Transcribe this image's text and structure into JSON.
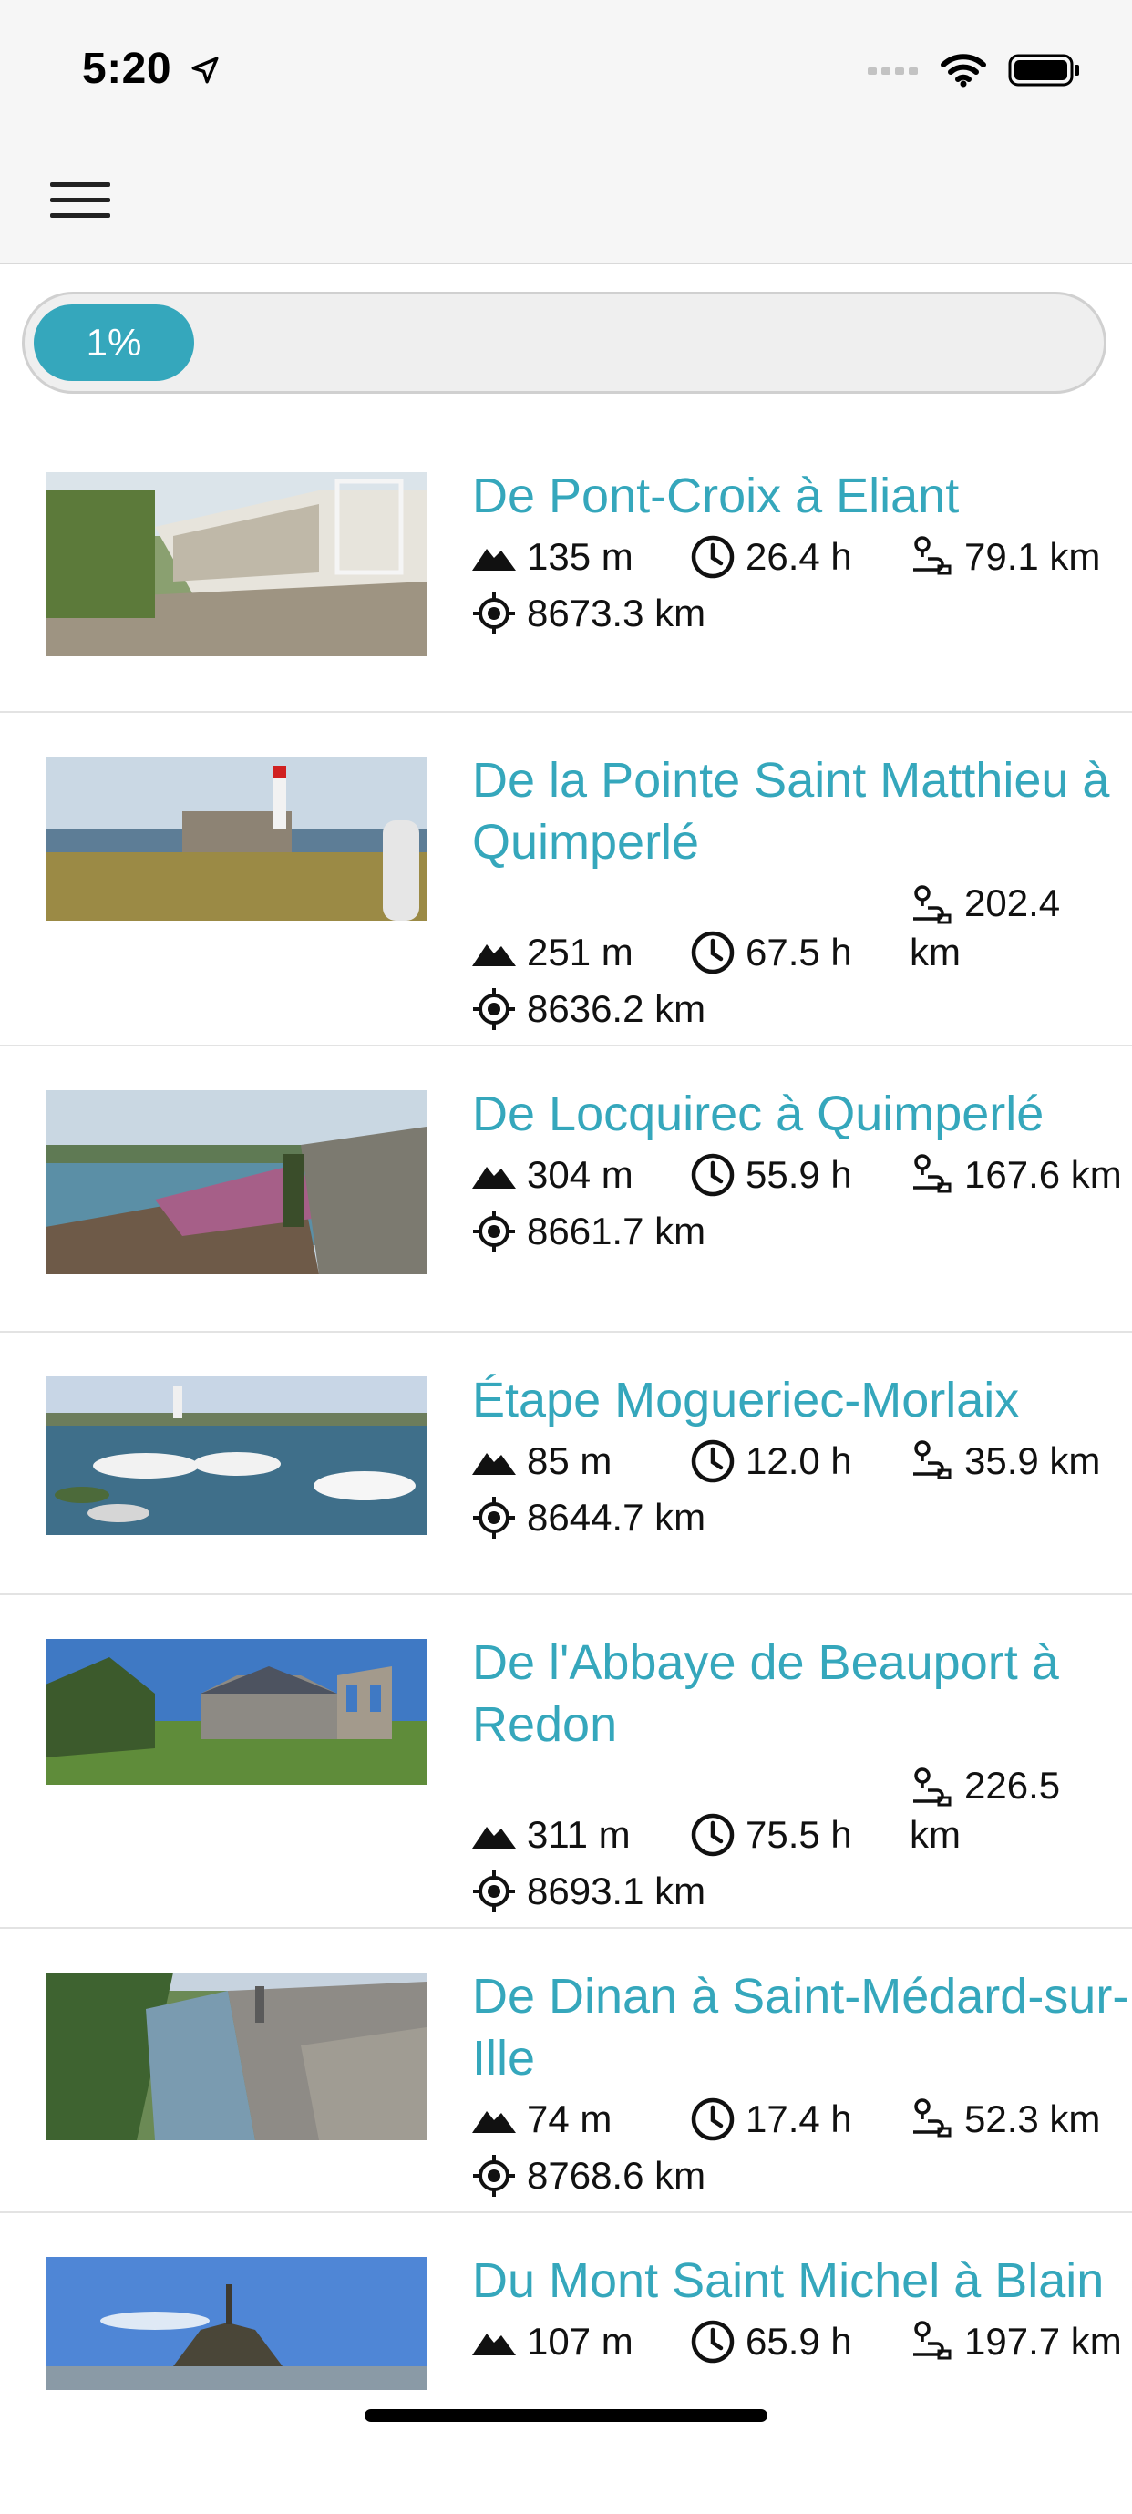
{
  "status": {
    "time": "5:20"
  },
  "progress": {
    "label": "1%",
    "value": 0.01
  },
  "items": [
    {
      "title": "De Pont-Croix à Eliant",
      "elevation": "135 m",
      "duration": "26.4 h",
      "distance": "79.1 km",
      "position": "8673.3 km"
    },
    {
      "title": "De la Pointe Saint Matthieu à Quimperlé",
      "elevation": "251 m",
      "duration": "67.5 h",
      "distance": "202.4 km",
      "position": "8636.2 km"
    },
    {
      "title": "De Locquirec à Quimperlé",
      "elevation": "304 m",
      "duration": "55.9 h",
      "distance": "167.6 km",
      "position": "8661.7 km"
    },
    {
      "title": "Étape Mogueriec-Morlaix",
      "elevation": "85 m",
      "duration": "12.0 h",
      "distance": "35.9 km",
      "position": "8644.7 km"
    },
    {
      "title": "De l'Abbaye de Beauport à Redon",
      "elevation": "311 m",
      "duration": "75.5 h",
      "distance": "226.5 km",
      "position": "8693.1 km"
    },
    {
      "title": "De Dinan à Saint-Médard-sur-Ille",
      "elevation": "74 m",
      "duration": "17.4 h",
      "distance": "52.3 km",
      "position": "8768.6 km"
    },
    {
      "title": "Du Mont Saint Michel à Blain",
      "elevation": "107 m",
      "duration": "65.9 h",
      "distance": "197.7 km",
      "position": ""
    }
  ],
  "colors": {
    "accent": "#35a7bc",
    "bar": "#f6f6f6"
  }
}
